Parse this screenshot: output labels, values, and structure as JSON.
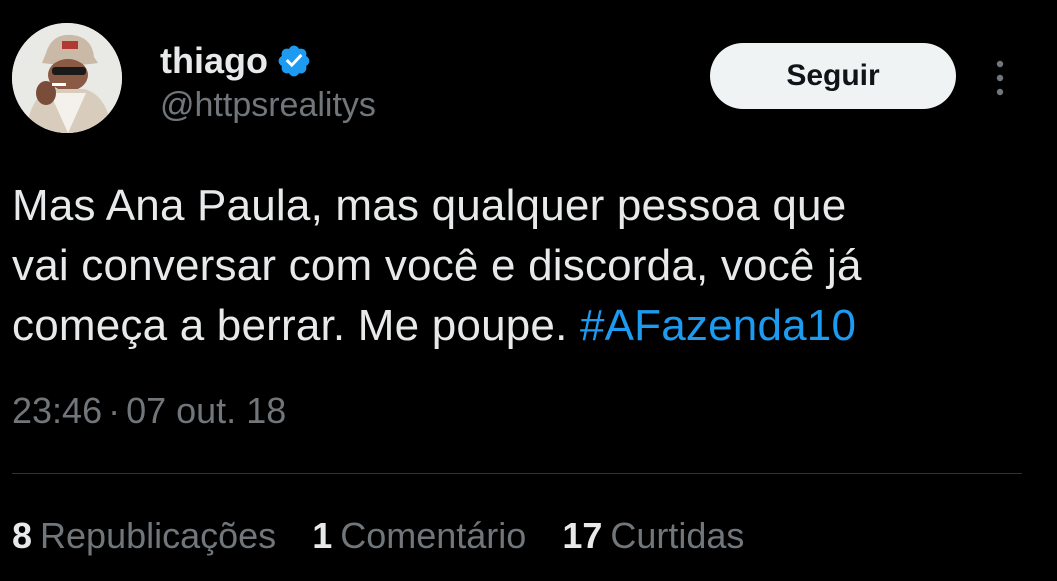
{
  "author": {
    "display_name": "thiago",
    "handle": "@httpsrealitys",
    "verified": true,
    "verified_icon": "verified-badge-icon",
    "avatar_icon": "avatar-photo"
  },
  "follow_button": {
    "label": "Seguir"
  },
  "more_menu": {
    "icon": "more-vertical-icon"
  },
  "tweet": {
    "text_line1": "Mas Ana Paula, mas qualquer pessoa que",
    "text_line2": "vai conversar com você e discorda, você já",
    "text_line3_prefix": "começa a berrar. Me poupe. ",
    "hashtag": "#AFazenda10"
  },
  "meta": {
    "time": "23:46",
    "separator": "·",
    "date": "07 out. 18"
  },
  "stats": [
    {
      "count": "8",
      "label": "Republicações"
    },
    {
      "count": "1",
      "label": "Comentário"
    },
    {
      "count": "17",
      "label": "Curtidas"
    }
  ],
  "colors": {
    "background": "#000000",
    "text_primary": "#e7e9ea",
    "text_secondary": "#71767b",
    "accent": "#1d9bf0",
    "divider": "#2f3336",
    "button_bg": "#eff3f4"
  }
}
